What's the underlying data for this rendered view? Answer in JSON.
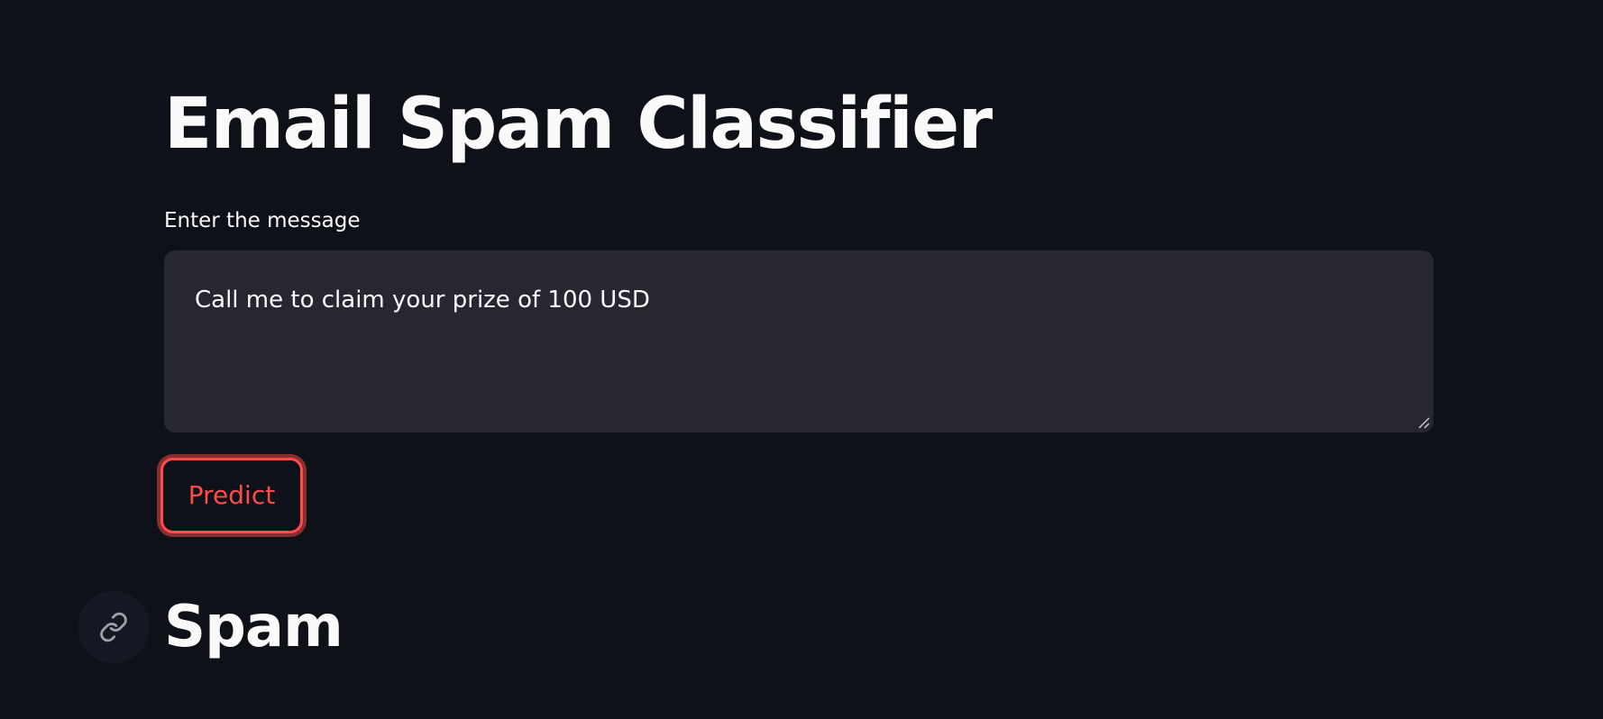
{
  "app": {
    "title": "Email Spam Classifier"
  },
  "form": {
    "message_label": "Enter the message",
    "message_value": "Call me to claim your prize of 100 USD",
    "predict_label": "Predict"
  },
  "result": {
    "heading": "Spam",
    "anchor_icon": "link-icon"
  },
  "colors": {
    "background": "#0e1117",
    "input_background": "#262730",
    "accent": "#ff4b4b",
    "text": "#fafafa"
  }
}
